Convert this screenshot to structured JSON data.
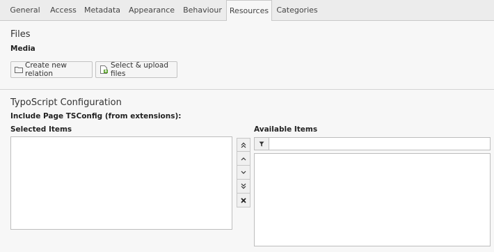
{
  "tabs": [
    {
      "label": "General",
      "active": false
    },
    {
      "label": "Access",
      "active": false
    },
    {
      "label": "Metadata",
      "active": false
    },
    {
      "label": "Appearance",
      "active": false
    },
    {
      "label": "Behaviour",
      "active": false
    },
    {
      "label": "Resources",
      "active": true
    },
    {
      "label": "Categories",
      "active": false
    }
  ],
  "files": {
    "section_title": "Files",
    "media_label": "Media",
    "create_relation_label": "Create new relation",
    "select_upload_label": "Select & upload files"
  },
  "typoscript": {
    "section_title": "TypoScript Configuration",
    "include_label": "Include Page TSConfig (from extensions):",
    "selected_items_label": "Selected Items",
    "available_items_label": "Available Items",
    "filter_value": "",
    "filter_placeholder": ""
  },
  "icons": {
    "create_relation": "folder-icon",
    "select_upload": "file-upload-icon",
    "move_top": "double-chevron-up-icon",
    "move_up": "chevron-up-icon",
    "move_down": "chevron-down-icon",
    "move_bottom": "double-chevron-down-icon",
    "remove": "close-icon",
    "filter": "filter-icon"
  },
  "colors": {
    "upload_icon_accent": "#5aa02c"
  }
}
